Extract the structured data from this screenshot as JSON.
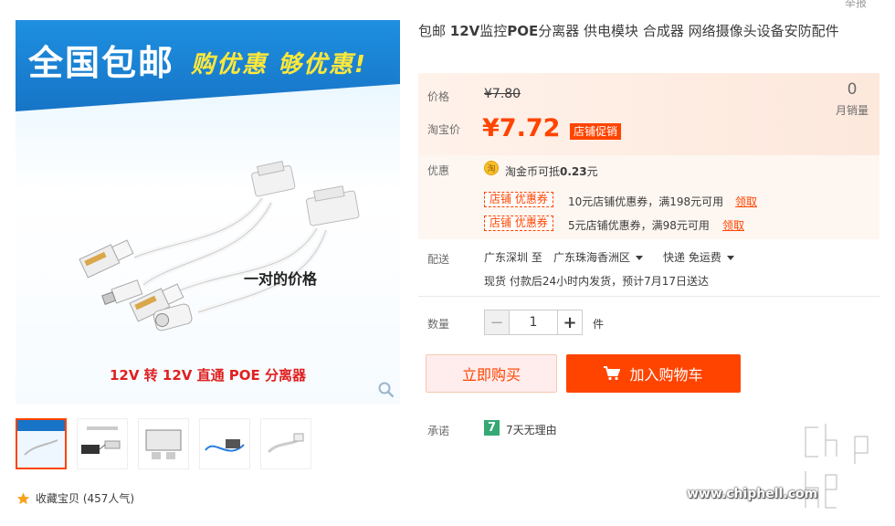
{
  "header": {
    "report_link": "举报"
  },
  "product": {
    "title_prefix": "包邮 ",
    "title_bold1": "12V",
    "title_mid1": "监控",
    "title_bold2": "POE",
    "title_rest": "分离器 供电模块 合成器 网络摄像头设备安防配件"
  },
  "gallery": {
    "banner_left": "全国包邮",
    "banner_right": "购优惠  够优惠!",
    "pair_text": "一对的价格",
    "bottom_text": "12V 转 12V 直通 POE 分离器",
    "thumb_count": 5,
    "active_thumb": 0
  },
  "favorite": {
    "label": "收藏宝贝 (457人气)"
  },
  "pricing": {
    "price_label": "价格",
    "old_price": "¥7.80",
    "taobao_label": "淘宝价",
    "price": "¥7.72",
    "promo_tag": "店铺促销",
    "sales_count": "0",
    "sales_label": "月销量"
  },
  "promotions": {
    "label": "优惠",
    "coin_icon": "coin-icon",
    "coin_text_prefix": "淘金币可抵",
    "coin_amount": "0.23",
    "coin_text_suffix": "元",
    "coupons": [
      {
        "tag": "店铺  优惠券",
        "text": "10元店铺优惠券，满198元可用",
        "action": "领取"
      },
      {
        "tag": "店铺  优惠券",
        "text": "5元店铺优惠券，满98元可用",
        "action": "领取"
      }
    ]
  },
  "shipping": {
    "label": "配送",
    "from": "广东深圳 至",
    "to": "广东珠海香洲区",
    "method": "快递 免运费",
    "info": "现货 付款后24小时内发货，预计7月17日送达"
  },
  "quantity": {
    "label": "数量",
    "value": "1",
    "unit": "件",
    "minus": "−",
    "plus": "+"
  },
  "actions": {
    "buy_now": "立即购买",
    "add_to_cart": "加入购物车"
  },
  "promise": {
    "label": "承诺",
    "icon_text": "7",
    "text": "7天无理由"
  },
  "watermark": {
    "url": "www.chiphell.com"
  },
  "colors": {
    "accent": "#ff4400",
    "price_bg": "#fdeee5",
    "promise_green": "#35a874"
  }
}
